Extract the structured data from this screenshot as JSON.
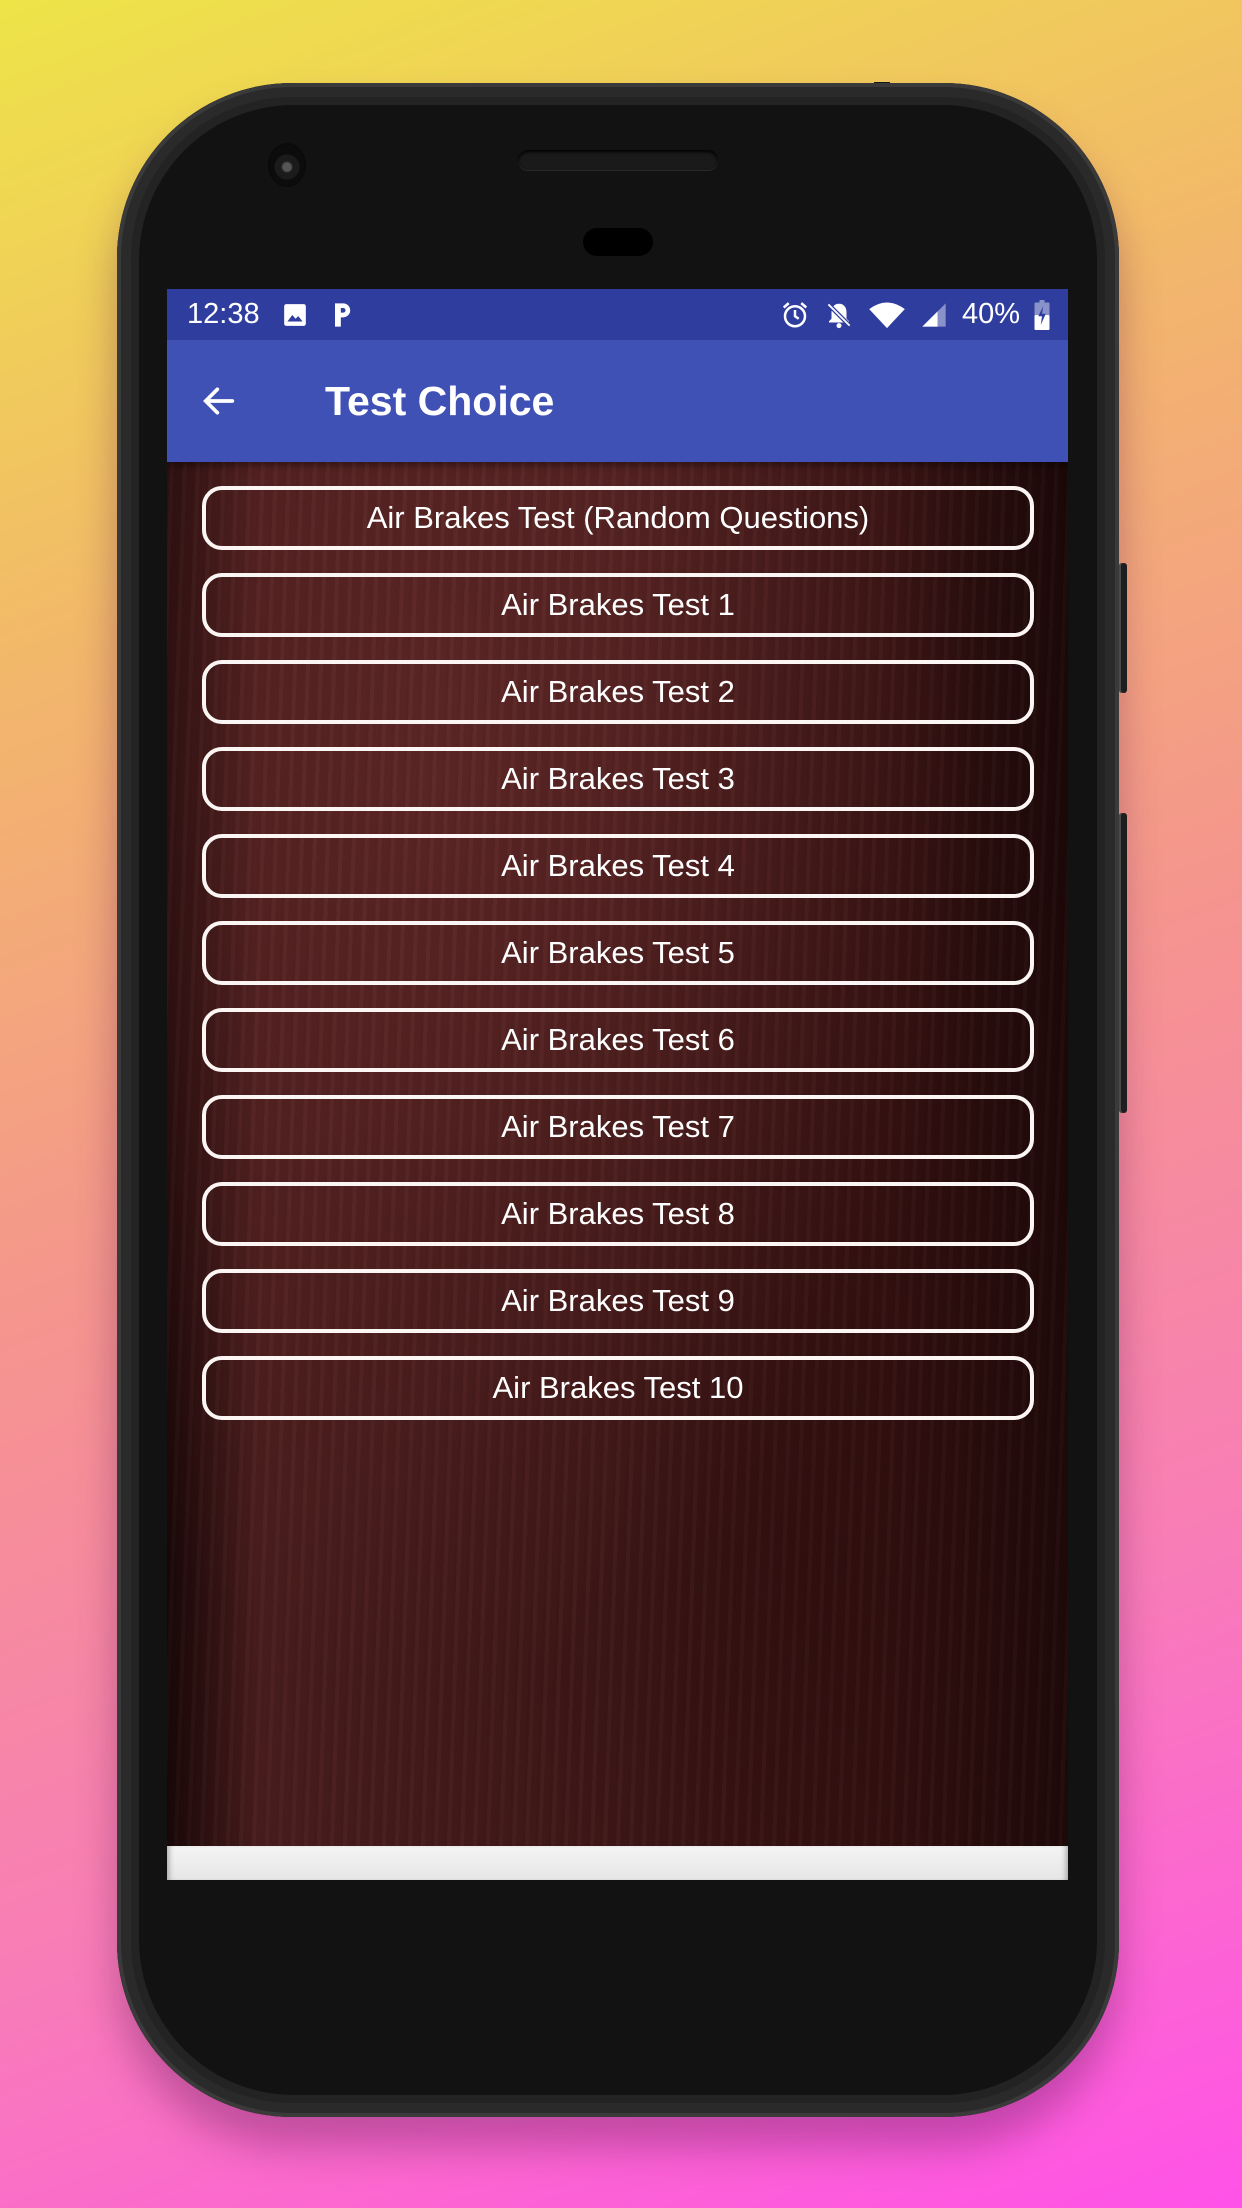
{
  "statusbar": {
    "time": "12:38",
    "battery": "40%",
    "left_icons": [
      "image-icon",
      "parking-p-icon"
    ],
    "right_icons": [
      "alarm-icon",
      "notifications-off-icon",
      "wifi-icon",
      "signal-icon",
      "battery-charging-icon"
    ]
  },
  "appbar": {
    "back_icon": "arrow-left-icon",
    "title": "Test Choice"
  },
  "tests": [
    {
      "label": "Air Brakes Test (Random Questions)"
    },
    {
      "label": "Air Brakes Test 1"
    },
    {
      "label": "Air Brakes Test 2"
    },
    {
      "label": "Air Brakes Test 3"
    },
    {
      "label": "Air Brakes Test 4"
    },
    {
      "label": "Air Brakes Test 5"
    },
    {
      "label": "Air Brakes Test 6"
    },
    {
      "label": "Air Brakes Test 7"
    },
    {
      "label": "Air Brakes Test 8"
    },
    {
      "label": "Air Brakes Test 9"
    },
    {
      "label": "Air Brakes Test 10"
    }
  ],
  "colors": {
    "statusbar": "#2f3e9e",
    "appbar": "#3f51b5",
    "button_border": "#fbf6f3",
    "content_bg": "#4b1e1e"
  }
}
